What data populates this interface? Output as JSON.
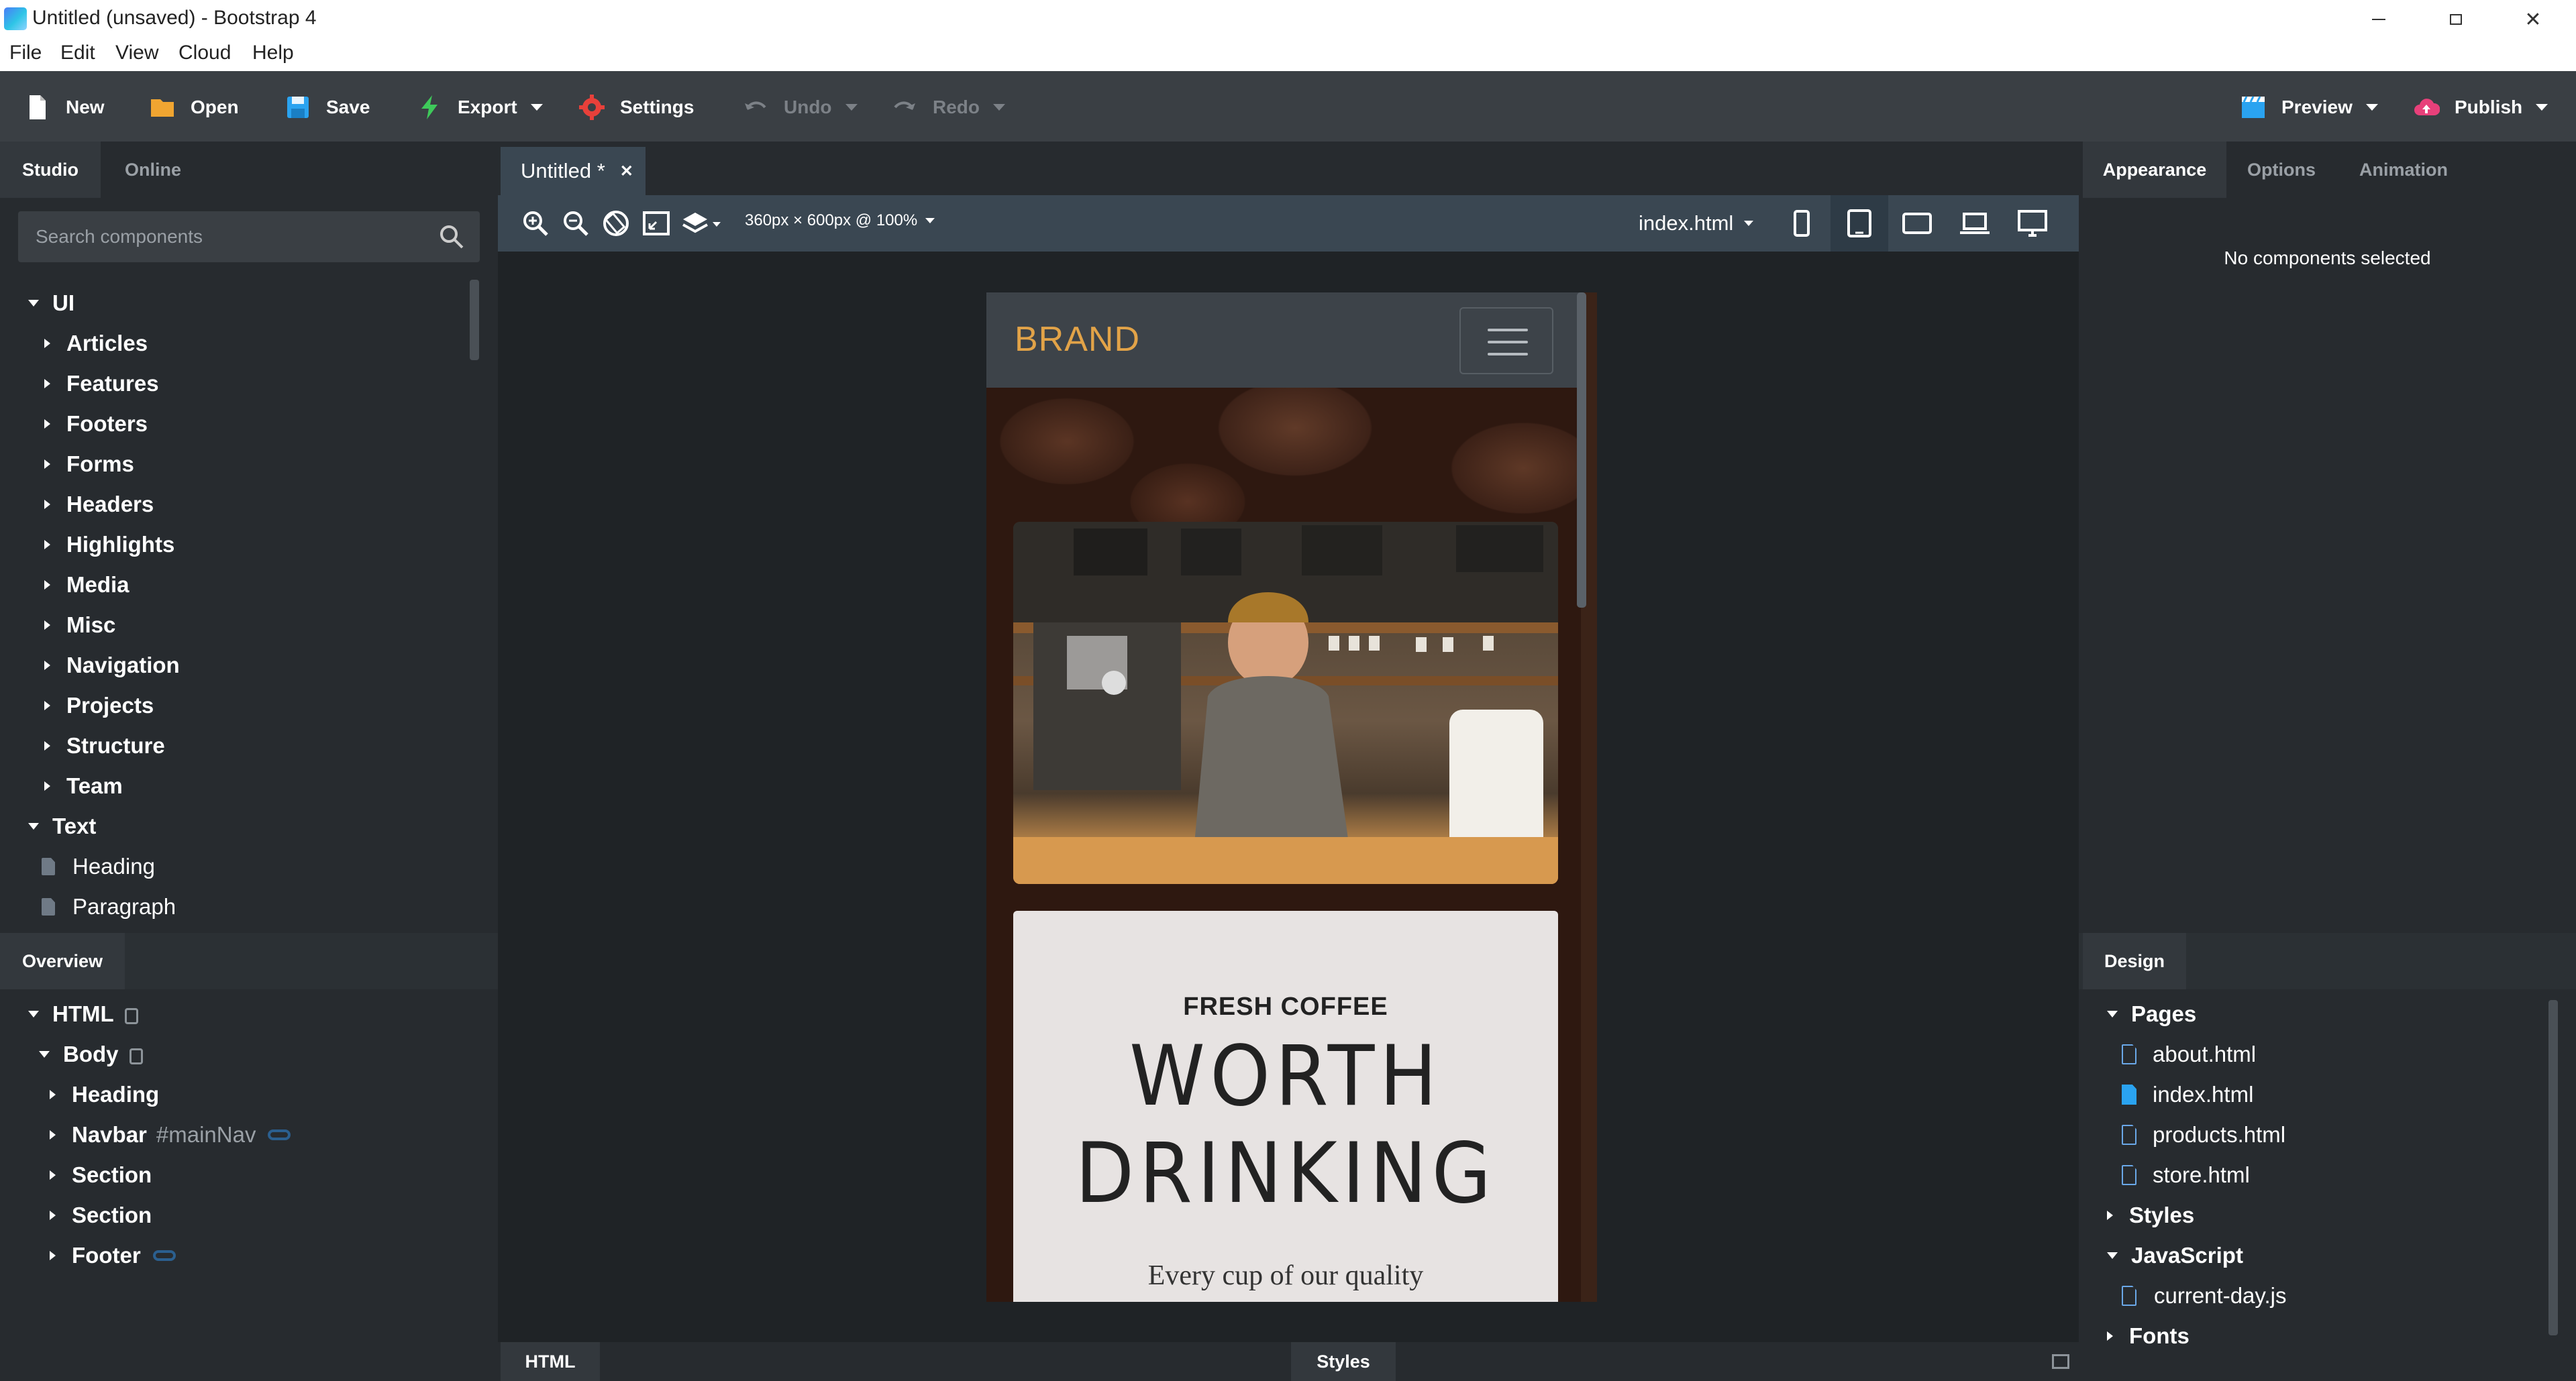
{
  "window": {
    "title": "Untitled (unsaved) - Bootstrap 4"
  },
  "menu": [
    "File",
    "Edit",
    "View",
    "Cloud",
    "Help"
  ],
  "toolbar": {
    "new": "New",
    "open": "Open",
    "save": "Save",
    "export": "Export",
    "settings": "Settings",
    "undo": "Undo",
    "redo": "Redo",
    "preview": "Preview",
    "publish": "Publish"
  },
  "left_panel": {
    "tabs": [
      "Studio",
      "Online"
    ],
    "search_placeholder": "Search components",
    "tree_root": "UI",
    "categories": [
      "Articles",
      "Features",
      "Footers",
      "Forms",
      "Headers",
      "Highlights",
      "Media",
      "Misc",
      "Navigation",
      "Projects",
      "Structure",
      "Team"
    ],
    "text_group": "Text",
    "text_items": [
      "Heading",
      "Paragraph"
    ]
  },
  "overview": {
    "title": "Overview",
    "html": "HTML",
    "body": "Body",
    "items": [
      {
        "label": "Heading",
        "id": ""
      },
      {
        "label": "Navbar",
        "id": "#mainNav"
      },
      {
        "label": "Section",
        "id": ""
      },
      {
        "label": "Section",
        "id": ""
      },
      {
        "label": "Footer",
        "id": ""
      }
    ]
  },
  "editor": {
    "tab_label": "Untitled *",
    "canvas_size": "360px × 600px @ 100%",
    "page": "index.html",
    "bottom_tabs": [
      "HTML",
      "Styles"
    ]
  },
  "preview": {
    "brand": "BRAND",
    "eyebrow": "FRESH COFFEE",
    "headline_1": "WORTH",
    "headline_2": "DRINKING",
    "tagline": "Every cup of our quality"
  },
  "right_panel": {
    "tabs": [
      "Appearance",
      "Options",
      "Animation"
    ],
    "empty_message": "No components selected",
    "design_title": "Design",
    "pages_label": "Pages",
    "pages": [
      "about.html",
      "index.html",
      "products.html",
      "store.html"
    ],
    "styles_label": "Styles",
    "javascript_label": "JavaScript",
    "scripts": [
      "current-day.js"
    ],
    "fonts_label": "Fonts"
  },
  "colors": {
    "toolbar_bg": "#3a3f44",
    "panel_bg": "#272b2f",
    "canvas_bg": "#1f2326",
    "brand_accent": "#e2a348",
    "file_active": "#2aa3f0"
  }
}
